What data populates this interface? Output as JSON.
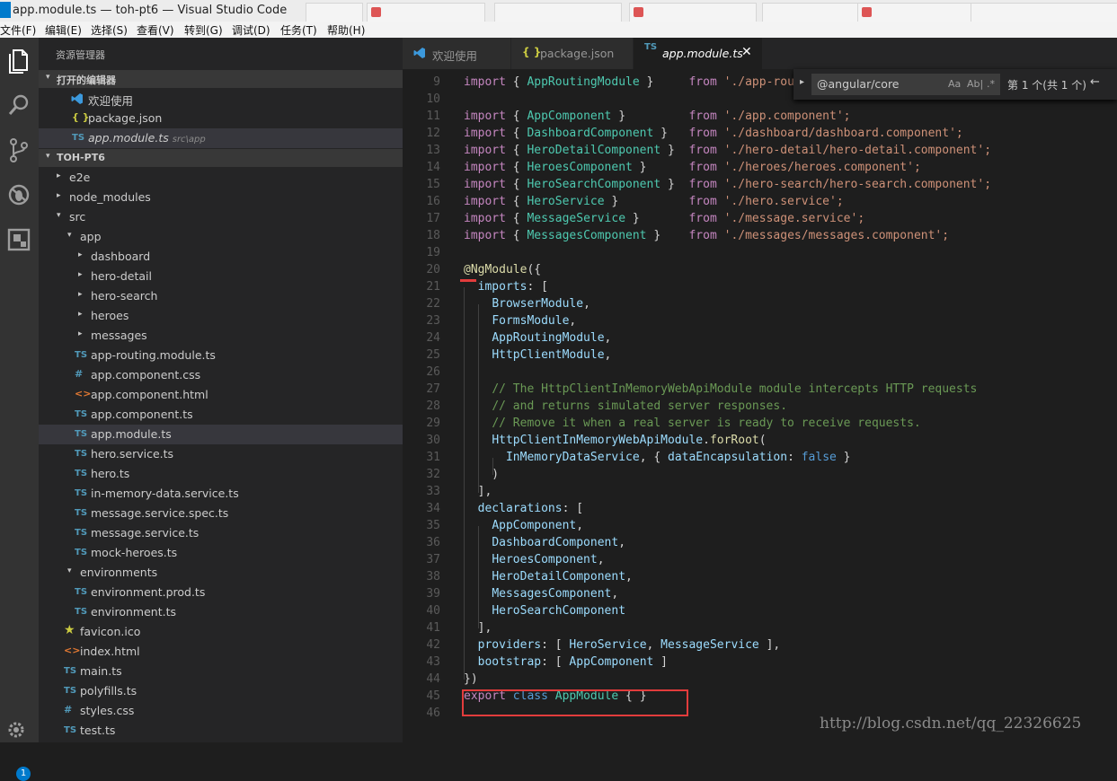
{
  "window": {
    "title": "app.module.ts — toh-pt6 — Visual Studio Code"
  },
  "menu": [
    "文件(F)",
    "编辑(E)",
    "选择(S)",
    "查看(V)",
    "转到(G)",
    "调试(D)",
    "任务(T)",
    "帮助(H)"
  ],
  "activity": {
    "badge": "1"
  },
  "sidebar": {
    "title": "资源管理器",
    "open_editors_label": "打开的编辑器",
    "open_editors": [
      {
        "name": "欢迎使用",
        "icon": "vscode-icon"
      },
      {
        "name": "package.json",
        "icon": "json-icon",
        "glyph": "{ }"
      },
      {
        "name": "app.module.ts",
        "path": "src\\app",
        "icon": "ts-icon",
        "glyph": "TS"
      }
    ],
    "project_label": "TOH-PT6",
    "tree": [
      {
        "name": "e2e",
        "type": "folder",
        "glyph": "▸"
      },
      {
        "name": "node_modules",
        "type": "folder",
        "glyph": "▸"
      },
      {
        "name": "src",
        "type": "folder",
        "glyph": "▾"
      },
      {
        "name": "app",
        "type": "folder",
        "glyph": "▾"
      },
      {
        "name": "dashboard",
        "type": "folder",
        "glyph": "▸"
      },
      {
        "name": "hero-detail",
        "type": "folder",
        "glyph": "▸"
      },
      {
        "name": "hero-search",
        "type": "folder",
        "glyph": "▸"
      },
      {
        "name": "heroes",
        "type": "folder",
        "glyph": "▸"
      },
      {
        "name": "messages",
        "type": "folder",
        "glyph": "▸"
      },
      {
        "name": "app-routing.module.ts",
        "type": "ts",
        "glyph": "TS"
      },
      {
        "name": "app.component.css",
        "type": "css",
        "glyph": "#"
      },
      {
        "name": "app.component.html",
        "type": "html",
        "glyph": "<>"
      },
      {
        "name": "app.component.ts",
        "type": "ts",
        "glyph": "TS"
      },
      {
        "name": "app.module.ts",
        "type": "ts",
        "glyph": "TS"
      },
      {
        "name": "hero.service.ts",
        "type": "ts",
        "glyph": "TS"
      },
      {
        "name": "hero.ts",
        "type": "ts",
        "glyph": "TS"
      },
      {
        "name": "in-memory-data.service.ts",
        "type": "ts",
        "glyph": "TS"
      },
      {
        "name": "message.service.spec.ts",
        "type": "ts",
        "glyph": "TS"
      },
      {
        "name": "message.service.ts",
        "type": "ts",
        "glyph": "TS"
      },
      {
        "name": "mock-heroes.ts",
        "type": "ts",
        "glyph": "TS"
      },
      {
        "name": "environments",
        "type": "folder",
        "glyph": "▾"
      },
      {
        "name": "environment.prod.ts",
        "type": "ts",
        "glyph": "TS"
      },
      {
        "name": "environment.ts",
        "type": "ts",
        "glyph": "TS"
      },
      {
        "name": "favicon.ico",
        "type": "star",
        "glyph": "★"
      },
      {
        "name": "index.html",
        "type": "html",
        "glyph": "<>"
      },
      {
        "name": "main.ts",
        "type": "ts",
        "glyph": "TS"
      },
      {
        "name": "polyfills.ts",
        "type": "ts",
        "glyph": "TS"
      },
      {
        "name": "styles.css",
        "type": "css",
        "glyph": "#"
      },
      {
        "name": "test.ts",
        "type": "ts",
        "glyph": "TS"
      }
    ]
  },
  "tabs": [
    {
      "label": "欢迎使用",
      "icon": "vscode-icon"
    },
    {
      "label": "package.json",
      "icon": "json-icon",
      "glyph": "{ }"
    },
    {
      "label": "app.module.ts",
      "icon": "ts-icon",
      "glyph": "TS",
      "close": "✕"
    }
  ],
  "find": {
    "query": "@angular/core",
    "opt_case": "Aa",
    "opt_word": "Ab|",
    "opt_regex": ".*",
    "result": "第 1 个(共 1 个)",
    "prev": "←"
  },
  "editor": {
    "lines": [
      {
        "n": "9",
        "t": [
          [
            "k",
            "import"
          ],
          [
            "p",
            " { "
          ],
          [
            "t",
            "AppRoutingModule"
          ],
          [
            "p",
            " }     "
          ],
          [
            "k",
            "from"
          ],
          [
            "p",
            " "
          ],
          [
            "s",
            "'./app-routing.module';"
          ]
        ]
      },
      {
        "n": "10",
        "t": []
      },
      {
        "n": "11",
        "t": [
          [
            "k",
            "import"
          ],
          [
            "p",
            " { "
          ],
          [
            "t",
            "AppComponent"
          ],
          [
            "p",
            " }         "
          ],
          [
            "k",
            "from"
          ],
          [
            "p",
            " "
          ],
          [
            "s",
            "'./app.component';"
          ]
        ]
      },
      {
        "n": "12",
        "t": [
          [
            "k",
            "import"
          ],
          [
            "p",
            " { "
          ],
          [
            "t",
            "DashboardComponent"
          ],
          [
            "p",
            " }   "
          ],
          [
            "k",
            "from"
          ],
          [
            "p",
            " "
          ],
          [
            "s",
            "'./dashboard/dashboard.component';"
          ]
        ]
      },
      {
        "n": "13",
        "t": [
          [
            "k",
            "import"
          ],
          [
            "p",
            " { "
          ],
          [
            "t",
            "HeroDetailComponent"
          ],
          [
            "p",
            " }  "
          ],
          [
            "k",
            "from"
          ],
          [
            "p",
            " "
          ],
          [
            "s",
            "'./hero-detail/hero-detail.component';"
          ]
        ]
      },
      {
        "n": "14",
        "t": [
          [
            "k",
            "import"
          ],
          [
            "p",
            " { "
          ],
          [
            "t",
            "HeroesComponent"
          ],
          [
            "p",
            " }      "
          ],
          [
            "k",
            "from"
          ],
          [
            "p",
            " "
          ],
          [
            "s",
            "'./heroes/heroes.component';"
          ]
        ]
      },
      {
        "n": "15",
        "t": [
          [
            "k",
            "import"
          ],
          [
            "p",
            " { "
          ],
          [
            "t",
            "HeroSearchComponent"
          ],
          [
            "p",
            " }  "
          ],
          [
            "k",
            "from"
          ],
          [
            "p",
            " "
          ],
          [
            "s",
            "'./hero-search/hero-search.component';"
          ]
        ]
      },
      {
        "n": "16",
        "t": [
          [
            "k",
            "import"
          ],
          [
            "p",
            " { "
          ],
          [
            "t",
            "HeroService"
          ],
          [
            "p",
            " }          "
          ],
          [
            "k",
            "from"
          ],
          [
            "p",
            " "
          ],
          [
            "s",
            "'./hero.service';"
          ]
        ]
      },
      {
        "n": "17",
        "t": [
          [
            "k",
            "import"
          ],
          [
            "p",
            " { "
          ],
          [
            "t",
            "MessageService"
          ],
          [
            "p",
            " }       "
          ],
          [
            "k",
            "from"
          ],
          [
            "p",
            " "
          ],
          [
            "s",
            "'./message.service';"
          ]
        ]
      },
      {
        "n": "18",
        "t": [
          [
            "k",
            "import"
          ],
          [
            "p",
            " { "
          ],
          [
            "t",
            "MessagesComponent"
          ],
          [
            "p",
            " }    "
          ],
          [
            "k",
            "from"
          ],
          [
            "p",
            " "
          ],
          [
            "s",
            "'./messages/messages.component';"
          ]
        ]
      },
      {
        "n": "19",
        "t": []
      },
      {
        "n": "20",
        "t": [
          [
            "f",
            "@NgModule"
          ],
          [
            "p",
            "({"
          ]
        ]
      },
      {
        "n": "21",
        "t": [
          [
            "p",
            "  "
          ],
          [
            "v",
            "imports"
          ],
          [
            "p",
            ": ["
          ]
        ]
      },
      {
        "n": "22",
        "t": [
          [
            "p",
            "    "
          ],
          [
            "v",
            "BrowserModule"
          ],
          [
            "p",
            ","
          ]
        ]
      },
      {
        "n": "23",
        "t": [
          [
            "p",
            "    "
          ],
          [
            "v",
            "FormsModule"
          ],
          [
            "p",
            ","
          ]
        ]
      },
      {
        "n": "24",
        "t": [
          [
            "p",
            "    "
          ],
          [
            "v",
            "AppRoutingModule"
          ],
          [
            "p",
            ","
          ]
        ]
      },
      {
        "n": "25",
        "t": [
          [
            "p",
            "    "
          ],
          [
            "v",
            "HttpClientModule"
          ],
          [
            "p",
            ","
          ]
        ]
      },
      {
        "n": "26",
        "t": []
      },
      {
        "n": "27",
        "t": [
          [
            "p",
            "    "
          ],
          [
            "c",
            "// The HttpClientInMemoryWebApiModule module intercepts HTTP requests"
          ]
        ]
      },
      {
        "n": "28",
        "t": [
          [
            "p",
            "    "
          ],
          [
            "c",
            "// and returns simulated server responses."
          ]
        ]
      },
      {
        "n": "29",
        "t": [
          [
            "p",
            "    "
          ],
          [
            "c",
            "// Remove it when a real server is ready to receive requests."
          ]
        ]
      },
      {
        "n": "30",
        "t": [
          [
            "p",
            "    "
          ],
          [
            "v",
            "HttpClientInMemoryWebApiModule"
          ],
          [
            "p",
            "."
          ],
          [
            "f",
            "forRoot"
          ],
          [
            "p",
            "("
          ]
        ]
      },
      {
        "n": "31",
        "t": [
          [
            "p",
            "      "
          ],
          [
            "v",
            "InMemoryDataService"
          ],
          [
            "p",
            ", { "
          ],
          [
            "v",
            "dataEncapsulation"
          ],
          [
            "p",
            ": "
          ],
          [
            "b",
            "false"
          ],
          [
            "p",
            " }"
          ]
        ]
      },
      {
        "n": "32",
        "t": [
          [
            "p",
            "    )"
          ]
        ]
      },
      {
        "n": "33",
        "t": [
          [
            "p",
            "  ],"
          ]
        ]
      },
      {
        "n": "34",
        "t": [
          [
            "p",
            "  "
          ],
          [
            "v",
            "declarations"
          ],
          [
            "p",
            ": ["
          ]
        ]
      },
      {
        "n": "35",
        "t": [
          [
            "p",
            "    "
          ],
          [
            "v",
            "AppComponent"
          ],
          [
            "p",
            ","
          ]
        ]
      },
      {
        "n": "36",
        "t": [
          [
            "p",
            "    "
          ],
          [
            "v",
            "DashboardComponent"
          ],
          [
            "p",
            ","
          ]
        ]
      },
      {
        "n": "37",
        "t": [
          [
            "p",
            "    "
          ],
          [
            "v",
            "HeroesComponent"
          ],
          [
            "p",
            ","
          ]
        ]
      },
      {
        "n": "38",
        "t": [
          [
            "p",
            "    "
          ],
          [
            "v",
            "HeroDetailComponent"
          ],
          [
            "p",
            ","
          ]
        ]
      },
      {
        "n": "39",
        "t": [
          [
            "p",
            "    "
          ],
          [
            "v",
            "MessagesComponent"
          ],
          [
            "p",
            ","
          ]
        ]
      },
      {
        "n": "40",
        "t": [
          [
            "p",
            "    "
          ],
          [
            "v",
            "HeroSearchComponent"
          ]
        ]
      },
      {
        "n": "41",
        "t": [
          [
            "p",
            "  ],"
          ]
        ]
      },
      {
        "n": "42",
        "t": [
          [
            "p",
            "  "
          ],
          [
            "v",
            "providers"
          ],
          [
            "p",
            ": [ "
          ],
          [
            "v",
            "HeroService"
          ],
          [
            "p",
            ", "
          ],
          [
            "v",
            "MessageService"
          ],
          [
            "p",
            " ],"
          ]
        ]
      },
      {
        "n": "43",
        "t": [
          [
            "p",
            "  "
          ],
          [
            "v",
            "bootstrap"
          ],
          [
            "p",
            ": [ "
          ],
          [
            "v",
            "AppComponent"
          ],
          [
            "p",
            " ]"
          ]
        ]
      },
      {
        "n": "44",
        "t": [
          [
            "p",
            "})"
          ]
        ]
      },
      {
        "n": "45",
        "t": [
          [
            "k",
            "export"
          ],
          [
            "p",
            " "
          ],
          [
            "b",
            "class"
          ],
          [
            "p",
            " "
          ],
          [
            "t",
            "AppModule"
          ],
          [
            "p",
            " { }"
          ]
        ]
      },
      {
        "n": "46",
        "t": []
      }
    ]
  },
  "watermark": "http://blog.csdn.net/qq_22326625"
}
